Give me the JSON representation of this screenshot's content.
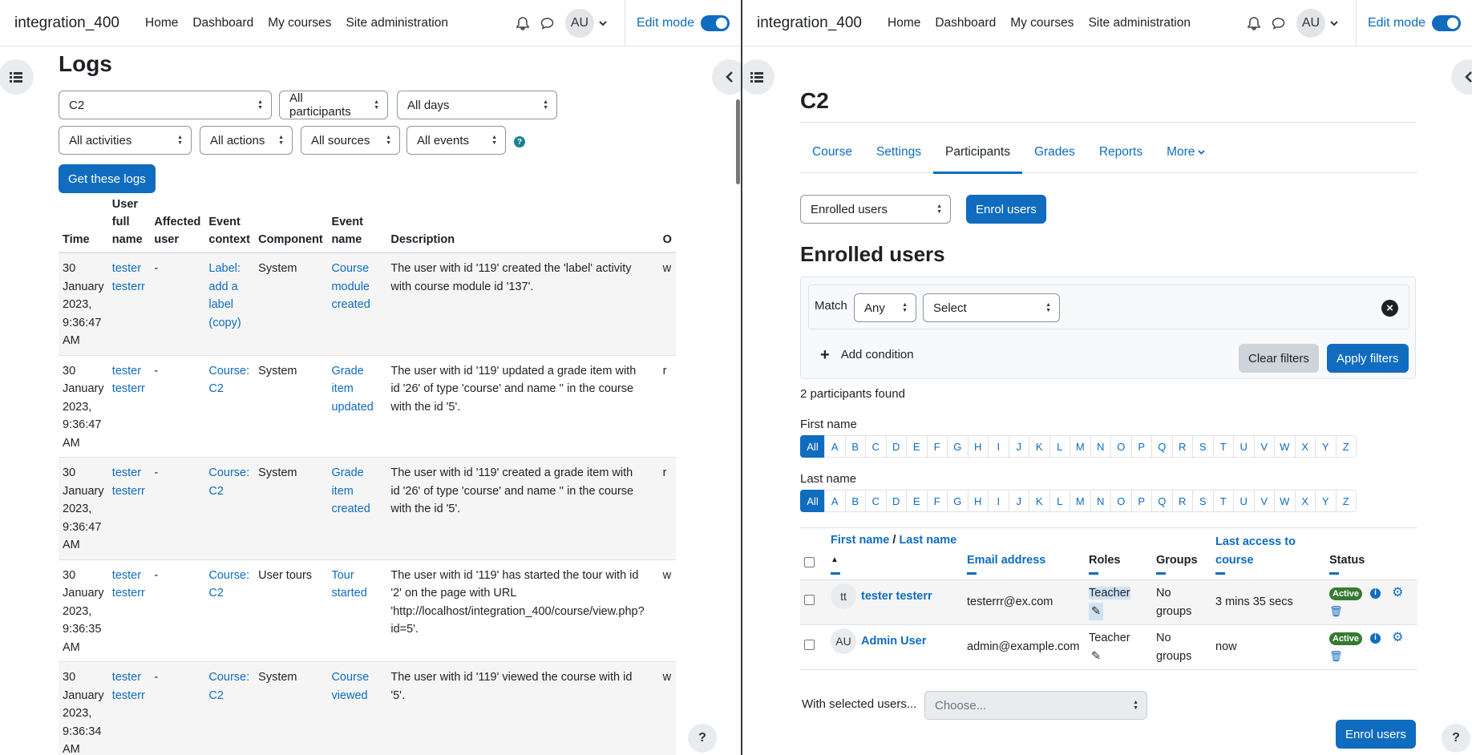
{
  "site": {
    "name": "integration_400",
    "nav": [
      "Home",
      "Dashboard",
      "My courses",
      "Site administration"
    ],
    "user_initials": "AU",
    "edit_mode_label": "Edit mode"
  },
  "logs": {
    "heading": "Logs",
    "filters": {
      "course": "C2",
      "participants": "All participants",
      "days": "All days",
      "activities": "All activities",
      "actions": "All actions",
      "sources": "All sources",
      "events": "All events"
    },
    "get_button": "Get these logs",
    "columns": {
      "time": "Time",
      "user_full_name": [
        "User",
        "full",
        "name"
      ],
      "affected_user": [
        "Affected",
        "user"
      ],
      "event_context": [
        "Event",
        "context"
      ],
      "component": "Component",
      "event_name": [
        "Event",
        "name"
      ],
      "description": "Description",
      "origin": "O"
    },
    "rows": [
      {
        "time": [
          "30",
          "January",
          "2023,",
          "9:36:47",
          "AM"
        ],
        "user": [
          "tester",
          "testerr"
        ],
        "affected": "-",
        "context": [
          "Label:",
          "add a",
          "label",
          "(copy)"
        ],
        "component": "System",
        "event": [
          "Course",
          "module",
          "created"
        ],
        "description": "The user with id '119' created the 'label' activity with course module id '137'.",
        "origin": "w"
      },
      {
        "time": [
          "30",
          "January",
          "2023,",
          "9:36:47",
          "AM"
        ],
        "user": [
          "tester",
          "testerr"
        ],
        "affected": "-",
        "context": [
          "Course:",
          "C2"
        ],
        "component": "System",
        "event": [
          "Grade item",
          "updated"
        ],
        "description": "The user with id '119' updated a grade item with id '26' of type 'course' and name '' in the course with the id '5'.",
        "origin": "r"
      },
      {
        "time": [
          "30",
          "January",
          "2023,",
          "9:36:47",
          "AM"
        ],
        "user": [
          "tester",
          "testerr"
        ],
        "affected": "-",
        "context": [
          "Course:",
          "C2"
        ],
        "component": "System",
        "event": [
          "Grade item",
          "created"
        ],
        "description": "The user with id '119' created a grade item with id '26' of type 'course' and name '' in the course with the id '5'.",
        "origin": "r"
      },
      {
        "time": [
          "30",
          "January",
          "2023,",
          "9:36:35",
          "AM"
        ],
        "user": [
          "tester",
          "testerr"
        ],
        "affected": "-",
        "context": [
          "Course:",
          "C2"
        ],
        "component": "User tours",
        "event": [
          "Tour",
          "started"
        ],
        "description": "The user with id '119' has started the tour with id '2' on the page with URL 'http://localhost/integration_400/course/view.php?id=5'.",
        "origin": "w"
      },
      {
        "time": [
          "30",
          "January",
          "2023,",
          "9:36:34",
          "AM"
        ],
        "user": [
          "tester",
          "testerr"
        ],
        "affected": "-",
        "context": [
          "Course:",
          "C2"
        ],
        "component": "System",
        "event": [
          "Course",
          "viewed"
        ],
        "description": "The user with id '119' viewed the course with id '5'.",
        "origin": "w"
      }
    ]
  },
  "course": {
    "title": "C2",
    "tabs": [
      "Course",
      "Settings",
      "Participants",
      "Grades",
      "Reports",
      "More"
    ],
    "active_tab": "Participants",
    "enrolled_select": "Enrolled users",
    "enrol_button": "Enrol users",
    "heading": "Enrolled users",
    "filter": {
      "match_label": "Match",
      "match_value": "Any",
      "select_value": "Select",
      "add_condition": "Add condition",
      "clear": "Clear filters",
      "apply": "Apply filters"
    },
    "found": "2 participants found",
    "first_name_label": "First name",
    "last_name_label": "Last name",
    "letters": [
      "All",
      "A",
      "B",
      "C",
      "D",
      "E",
      "F",
      "G",
      "H",
      "I",
      "J",
      "K",
      "L",
      "M",
      "N",
      "O",
      "P",
      "Q",
      "R",
      "S",
      "T",
      "U",
      "V",
      "W",
      "X",
      "Y",
      "Z"
    ],
    "columns": {
      "first_name": "First name",
      "slash": "/",
      "last_name": "Last name",
      "sort_arrow": "▲",
      "email": "Email address",
      "roles": "Roles",
      "groups": "Groups",
      "last_access": [
        "Last access to",
        "course"
      ],
      "status": "Status"
    },
    "participants": [
      {
        "initials": "tt",
        "name": "tester testerr",
        "email": "testerrr@ex.com",
        "role": "Teacher",
        "groups": [
          "No",
          "groups"
        ],
        "last_access": "3 mins 35 secs",
        "status": "Active"
      },
      {
        "initials": "AU",
        "name": "Admin User",
        "email": "admin@example.com",
        "role": "Teacher",
        "groups": [
          "No",
          "groups"
        ],
        "last_access": "now",
        "status": "Active"
      }
    ],
    "with_selected_label": "With selected users...",
    "choose_placeholder": "Choose...",
    "enrol_button_bottom": "Enrol users"
  },
  "help_label": "?"
}
